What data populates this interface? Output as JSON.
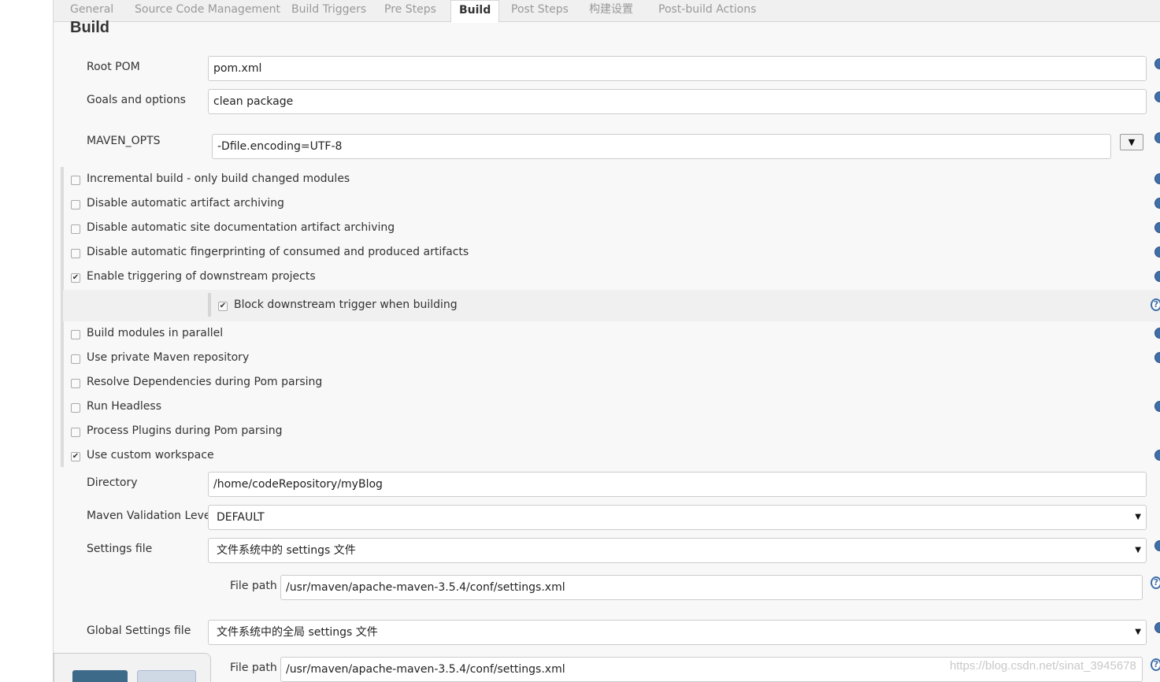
{
  "tabs": [
    {
      "label": "General"
    },
    {
      "label": "Source Code Management"
    },
    {
      "label": "Build Triggers"
    },
    {
      "label": "Pre Steps"
    },
    {
      "label": "Build"
    },
    {
      "label": "Post Steps"
    },
    {
      "label": "构建设置"
    },
    {
      "label": "Post-build Actions"
    }
  ],
  "active_tab": "Build",
  "section": {
    "title": "Build"
  },
  "root_pom": {
    "label": "Root POM",
    "value": "pom.xml"
  },
  "goals": {
    "label": "Goals and options",
    "value": "clean package"
  },
  "maven_opts": {
    "label": "MAVEN_OPTS",
    "value": "-Dfile.encoding=UTF-8",
    "toggle": "▼"
  },
  "options": [
    {
      "label": "Incremental build - only build changed modules",
      "checked": false
    },
    {
      "label": "Disable automatic artifact archiving",
      "checked": false
    },
    {
      "label": "Disable automatic site documentation artifact archiving",
      "checked": false
    },
    {
      "label": "Disable automatic fingerprinting of consumed and produced artifacts",
      "checked": false
    },
    {
      "label": "Enable triggering of downstream projects",
      "checked": true
    },
    {
      "label": "Block downstream trigger when building",
      "checked": true
    },
    {
      "label": "Build modules in parallel",
      "checked": false
    },
    {
      "label": "Use private Maven repository",
      "checked": false
    },
    {
      "label": "Resolve Dependencies during Pom parsing",
      "checked": false
    },
    {
      "label": "Run Headless",
      "checked": false
    },
    {
      "label": "Process Plugins during Pom parsing",
      "checked": false
    },
    {
      "label": "Use custom workspace",
      "checked": true
    }
  ],
  "directory": {
    "label": "Directory",
    "value": "/home/codeRepository/myBlog"
  },
  "validation": {
    "label": "Maven Validation Level",
    "value": "DEFAULT"
  },
  "settings": {
    "label": "Settings file",
    "value": "文件系统中的 settings 文件",
    "path_label": "File path",
    "path_value": "/usr/maven/apache-maven-3.5.4/conf/settings.xml"
  },
  "global_settings": {
    "label": "Global Settings file",
    "value": "文件系统中的全局 settings 文件",
    "path_label": "File path",
    "path_value": "/usr/maven/apache-maven-3.5.4/conf/settings.xml"
  },
  "watermark": "https://blog.csdn.net/sinat_3945678",
  "check_mark": "✔",
  "select_arrow": "▼",
  "help_glyph": "?",
  "colors": {
    "help": "#3f6fa8",
    "save_button": "#3e6a89",
    "apply_button": "#cfd9e6"
  }
}
